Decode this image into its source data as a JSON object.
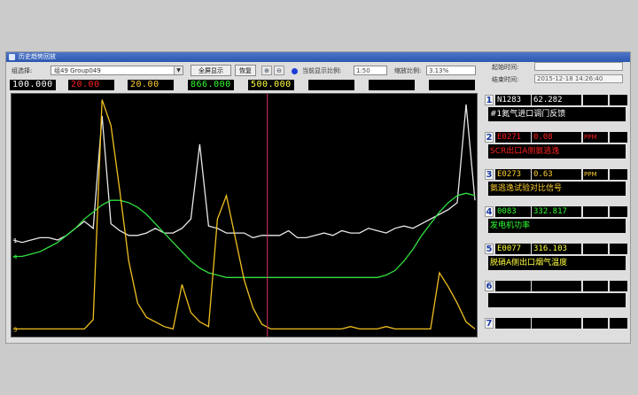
{
  "window": {
    "title": "历史趋势回放"
  },
  "toolbar": {
    "group_label": "组选择:",
    "group_value": "组49 Group049",
    "fullscreen_label": "全屏显示",
    "restore_label": "恢复",
    "display_ratio_label": "当前显示比例:",
    "display_ratio_value": "1:50",
    "zoom_ratio_label": "缩放比例:",
    "zoom_ratio_value": "3.13%"
  },
  "time_info": {
    "start_label": "起始时间:",
    "start_value": "",
    "end_label": "结束时间:",
    "end_value": "2015-12-18 14:26:40"
  },
  "readouts": [
    {
      "text": "100.000",
      "color": "#ffffff"
    },
    {
      "text": "20.00",
      "color": "#ff2020"
    },
    {
      "text": "20.00",
      "color": "#ffd030"
    },
    {
      "text": "866.000",
      "color": "#30ff30"
    },
    {
      "text": "500.000",
      "color": "#ffff40"
    },
    {
      "text": "",
      "color": "#ffffff"
    },
    {
      "text": "",
      "color": "#ffffff"
    },
    {
      "text": "",
      "color": "#ffffff"
    }
  ],
  "chart_data": {
    "type": "line",
    "cursor_position_ratio": 0.55,
    "series": [
      {
        "name": "1",
        "color": "#e8e8e8",
        "values": [
          0.39,
          0.38,
          0.39,
          0.4,
          0.4,
          0.39,
          0.41,
          0.44,
          0.47,
          0.44,
          0.92,
          0.46,
          0.43,
          0.41,
          0.41,
          0.42,
          0.44,
          0.42,
          0.42,
          0.44,
          0.48,
          0.8,
          0.45,
          0.44,
          0.42,
          0.42,
          0.42,
          0.4,
          0.41,
          0.41,
          0.41,
          0.43,
          0.4,
          0.4,
          0.41,
          0.42,
          0.41,
          0.43,
          0.42,
          0.42,
          0.44,
          0.43,
          0.42,
          0.44,
          0.45,
          0.44,
          0.46,
          0.48,
          0.5,
          0.52,
          0.55,
          0.97,
          0.56
        ]
      },
      {
        "name": "4",
        "color": "#30e040",
        "values": [
          0.32,
          0.32,
          0.33,
          0.34,
          0.36,
          0.38,
          0.41,
          0.44,
          0.48,
          0.51,
          0.54,
          0.56,
          0.56,
          0.55,
          0.53,
          0.5,
          0.46,
          0.42,
          0.38,
          0.34,
          0.3,
          0.27,
          0.25,
          0.24,
          0.23,
          0.23,
          0.23,
          0.23,
          0.23,
          0.23,
          0.23,
          0.23,
          0.23,
          0.23,
          0.23,
          0.23,
          0.23,
          0.23,
          0.23,
          0.23,
          0.23,
          0.23,
          0.24,
          0.26,
          0.3,
          0.35,
          0.41,
          0.46,
          0.51,
          0.55,
          0.58,
          0.59,
          0.58
        ]
      },
      {
        "name": "3",
        "color": "#f0c020",
        "values": [
          0.01,
          0.01,
          0.01,
          0.01,
          0.01,
          0.01,
          0.01,
          0.01,
          0.01,
          0.05,
          0.99,
          0.88,
          0.6,
          0.3,
          0.12,
          0.06,
          0.04,
          0.02,
          0.01,
          0.2,
          0.08,
          0.04,
          0.02,
          0.48,
          0.58,
          0.4,
          0.22,
          0.1,
          0.03,
          0.01,
          0.01,
          0.01,
          0.01,
          0.01,
          0.01,
          0.01,
          0.01,
          0.01,
          0.02,
          0.01,
          0.01,
          0.01,
          0.02,
          0.01,
          0.01,
          0.01,
          0.01,
          0.01,
          0.25,
          0.19,
          0.12,
          0.04,
          0.01
        ]
      }
    ]
  },
  "panel": {
    "slots": [
      {
        "num": "1",
        "code": "N1283",
        "code_color": "#ffffff",
        "value": "62.282",
        "unit": "",
        "unit_color": "#ffffff",
        "name": "#1氮气进口调门反馈",
        "name_color": "#ffffff"
      },
      {
        "num": "2",
        "code": "E0271",
        "code_color": "#ff2020",
        "value": "0.08",
        "unit": "PPM",
        "unit_color": "#ff2020",
        "name": "SCR出口A侧氨逃逸",
        "name_color": "#ff2020"
      },
      {
        "num": "3",
        "code": "E0273",
        "code_color": "#ffd030",
        "value": "0.63",
        "unit": "PPM",
        "unit_color": "#ffd030",
        "name": "氨逃逸试验对比信号",
        "name_color": "#ffd030"
      },
      {
        "num": "4",
        "code": "0083",
        "code_color": "#30ff30",
        "value": "332.817",
        "unit": "",
        "unit_color": "#30ff30",
        "name": "发电机功率",
        "name_color": "#30ff30"
      },
      {
        "num": "5",
        "code": "E0077",
        "code_color": "#ffff40",
        "value": "316.103",
        "unit": "",
        "unit_color": "#ffff40",
        "name": "脱硝A侧出口烟气温度",
        "name_color": "#ffff40"
      },
      {
        "num": "6",
        "code": "",
        "code_color": "#ffffff",
        "value": "",
        "unit": "",
        "unit_color": "#ffffff",
        "name": "",
        "name_color": "#ffffff"
      },
      {
        "num": "7",
        "code": "",
        "code_color": "#ffffff",
        "value": "",
        "unit": "",
        "unit_color": "#ffffff",
        "name": "",
        "name_color": "#ffffff"
      }
    ]
  }
}
